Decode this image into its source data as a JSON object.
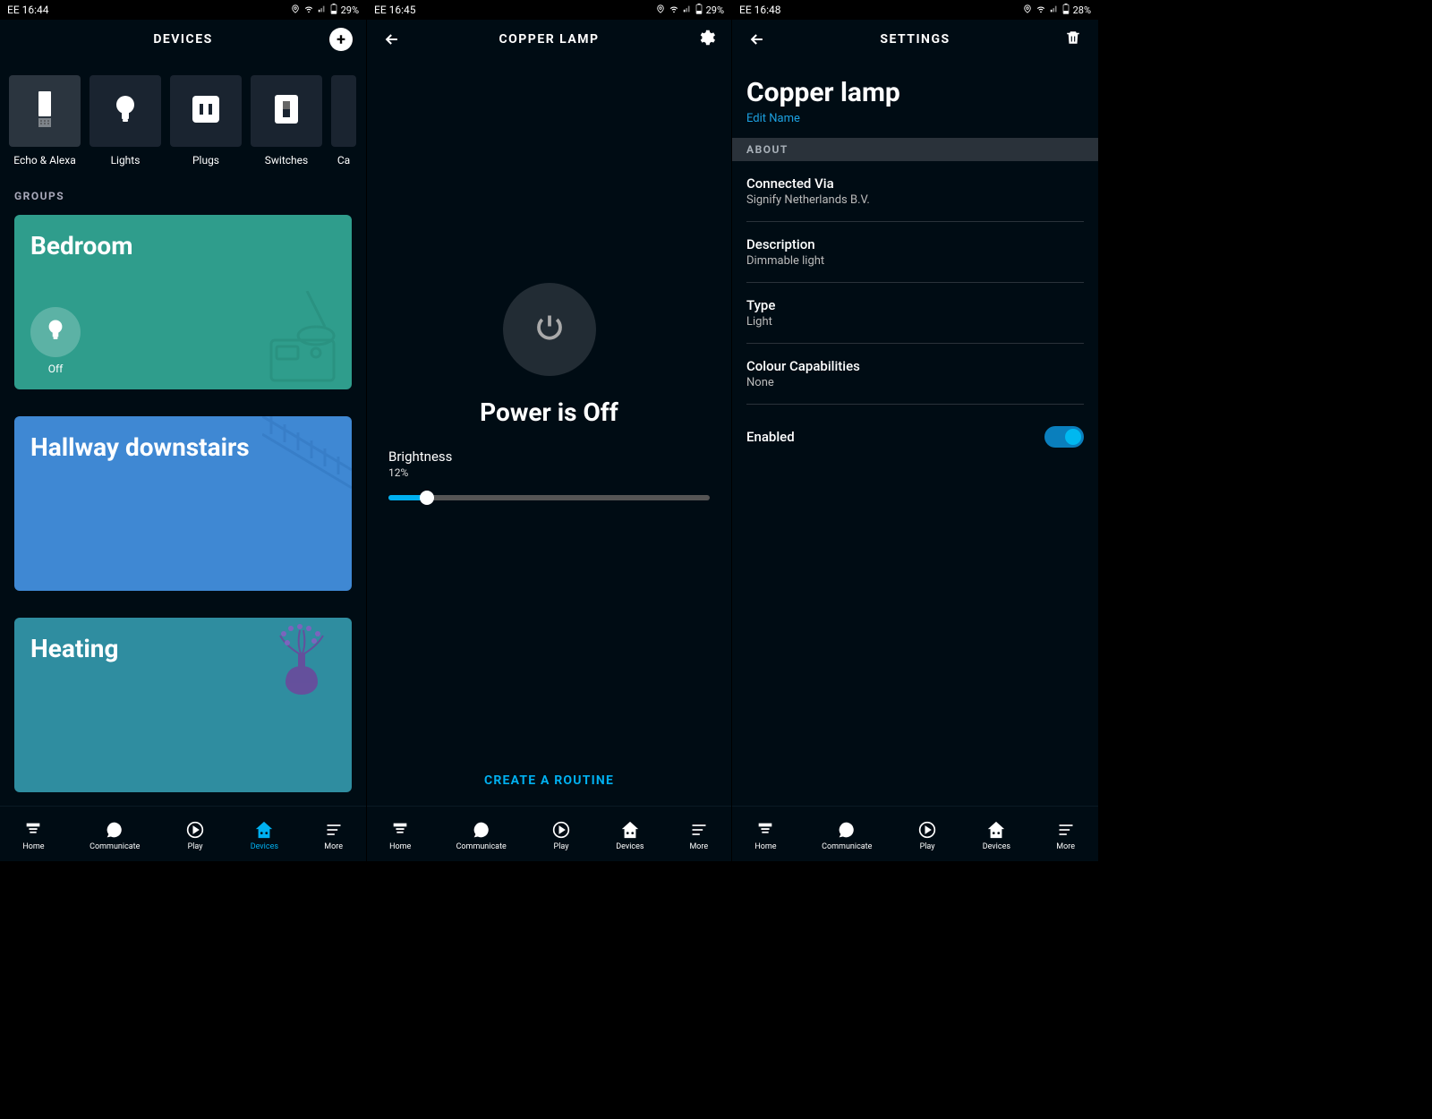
{
  "screens": [
    {
      "status": {
        "carrier": "EE",
        "time": "16:44",
        "battery": "29%"
      },
      "header": {
        "title": "DEVICES"
      },
      "categories": [
        {
          "label": "Echo & Alexa",
          "icon": "echo"
        },
        {
          "label": "Lights",
          "icon": "bulb"
        },
        {
          "label": "Plugs",
          "icon": "plug"
        },
        {
          "label": "Switches",
          "icon": "switch"
        },
        {
          "label": "Ca",
          "icon": "camera"
        }
      ],
      "groups_label": "GROUPS",
      "groups": [
        {
          "title": "Bedroom",
          "off_label": "Off"
        },
        {
          "title": "Hallway downstairs"
        },
        {
          "title": "Heating"
        }
      ]
    },
    {
      "status": {
        "carrier": "EE",
        "time": "16:45",
        "battery": "29%"
      },
      "header": {
        "title": "COPPER LAMP"
      },
      "power_text": "Power is Off",
      "brightness": {
        "label": "Brightness",
        "value_text": "12%",
        "value": 12
      },
      "create_routine": "CREATE A ROUTINE"
    },
    {
      "status": {
        "carrier": "EE",
        "time": "16:48",
        "battery": "28%"
      },
      "header": {
        "title": "SETTINGS"
      },
      "device_name": "Copper lamp",
      "edit_name": "Edit Name",
      "about_label": "ABOUT",
      "about": [
        {
          "label": "Connected Via",
          "value": "Signify Netherlands B.V."
        },
        {
          "label": "Description",
          "value": "Dimmable light"
        },
        {
          "label": "Type",
          "value": "Light"
        },
        {
          "label": "Colour Capabilities",
          "value": "None"
        }
      ],
      "enabled_label": "Enabled",
      "enabled": true
    }
  ],
  "nav": [
    {
      "label": "Home",
      "icon": "home"
    },
    {
      "label": "Communicate",
      "icon": "communicate"
    },
    {
      "label": "Play",
      "icon": "play"
    },
    {
      "label": "Devices",
      "icon": "devices"
    },
    {
      "label": "More",
      "icon": "more"
    }
  ]
}
